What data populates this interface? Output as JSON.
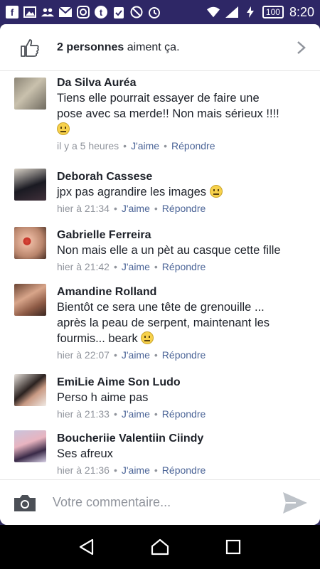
{
  "status": {
    "battery": "100",
    "time": "8:20"
  },
  "likes": {
    "count_text": "2 personnes",
    "suffix": " aiment ça."
  },
  "comments": [
    {
      "name": "Da Silva Auréa",
      "lines": [
        "Tiens elle pourrait essayer de faire une",
        "pose avec sa merde!! Non mais sérieux !!!!"
      ],
      "emoji_line": true,
      "time": "il y a 5 heures",
      "like": "J'aime",
      "reply": "Répondre"
    },
    {
      "name": "Deborah Cassese",
      "lines": [
        "jpx pas agrandire les images"
      ],
      "time": "hier à 21:34",
      "like": "J'aime",
      "reply": "Répondre"
    },
    {
      "name": "Gabrielle Ferreira",
      "lines": [
        "Non mais elle a un pèt au casque cette fille"
      ],
      "time": "hier à 21:42",
      "like": "J'aime",
      "reply": "Répondre"
    },
    {
      "name": "Amandine Rolland",
      "lines": [
        "Bientôt ce sera une tête de grenouille ...",
        "après la peau de serpent, maintenant les",
        "fourmis... beark"
      ],
      "time": "hier à 22:07",
      "like": "J'aime",
      "reply": "Répondre"
    },
    {
      "name": "EmiLie Aime Son Ludo",
      "lines": [
        "Perso h aime pas"
      ],
      "time": "hier à 21:33",
      "like": "J'aime",
      "reply": "Répondre"
    },
    {
      "name": "Boucheriie Valentiin Ciindy",
      "lines": [
        "Ses afreux"
      ],
      "time": "hier à 21:36",
      "like": "J'aime",
      "reply": "Répondre"
    }
  ],
  "composer": {
    "placeholder": "Votre commentaire..."
  },
  "colors": {
    "status_bar": "#2e2766",
    "link": "#4b6497",
    "meta": "#90949c"
  }
}
